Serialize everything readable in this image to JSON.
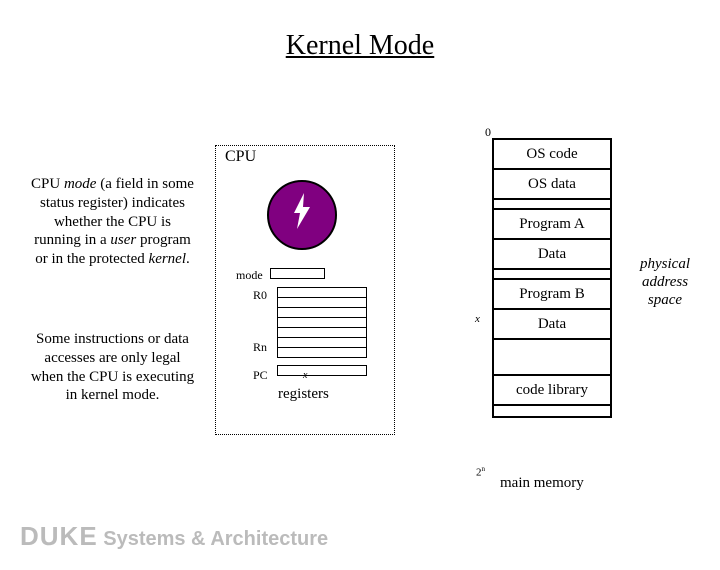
{
  "title": "Kernel Mode",
  "left_text_1_parts": {
    "p1": "CPU ",
    "p2": "mode",
    "p3": " (a field in some status register) indicates whether the CPU is running in a ",
    "p4": "user",
    "p5": " program or in the protected ",
    "p6": "kernel",
    "p7": "."
  },
  "left_text_2": "Some instructions or data accesses are only legal when the CPU is executing in kernel mode.",
  "cpu_label": "CPU",
  "mode_label": "mode",
  "r0": "R0",
  "rn": "Rn",
  "pc": "PC",
  "pc_x": "x",
  "registers_label": "registers",
  "mem_zero": "0",
  "mem_x": "x",
  "mem_2n": "2",
  "mem_2n_sup": "n",
  "memory": {
    "os_code": "OS code",
    "os_data": "OS data",
    "prog_a": "Program A",
    "data_a": "Data",
    "prog_b": "Program B",
    "data_b": "Data",
    "code_lib": "code library"
  },
  "main_memory": "main memory",
  "phys_label": "physical address space",
  "footer_duke": "DUKE",
  "footer_rest": " Systems & Architecture"
}
